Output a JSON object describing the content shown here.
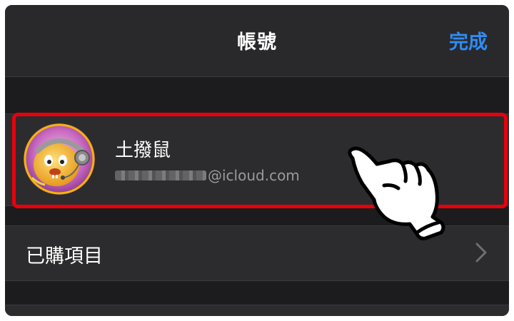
{
  "nav": {
    "title": "帳號",
    "done_label": "完成"
  },
  "account": {
    "name": "土撥鼠",
    "email_domain": "@icloud.com",
    "avatar_icon": "avatar-icon"
  },
  "menu": {
    "purchased_label": "已購項目",
    "chevron_icon": "chevron-right-icon"
  },
  "annotation": {
    "highlight_color": "#e8000b",
    "pointer_icon": "hand-pointer-icon"
  },
  "colors": {
    "accent": "#2f8cf5",
    "background": "#1c1c1e",
    "row": "#2c2c2e"
  }
}
